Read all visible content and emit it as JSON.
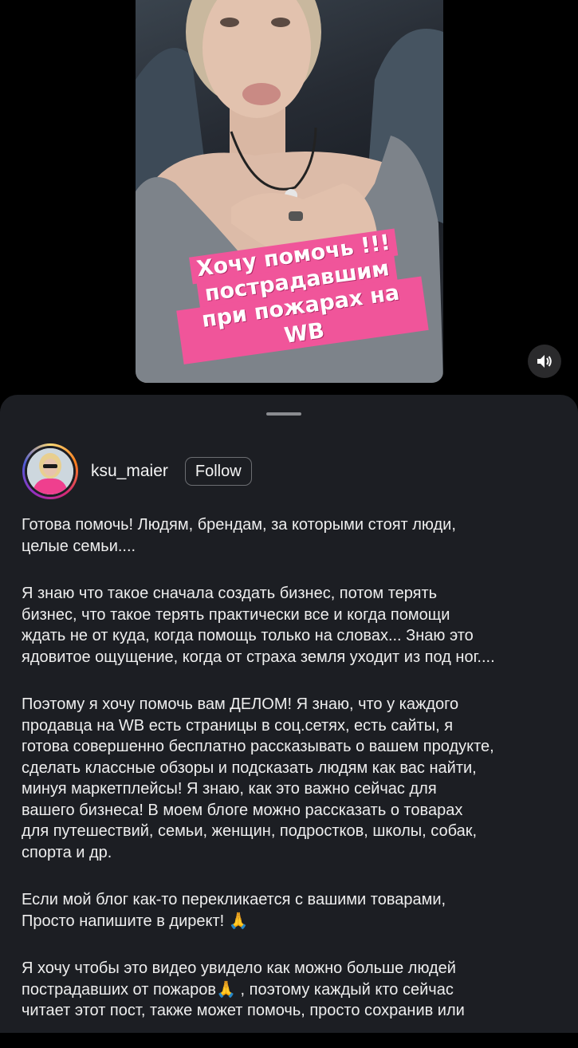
{
  "video": {
    "overlay_lines": [
      "Хочу помочь !!!",
      "пострадавшим",
      "при пожарах на WB"
    ],
    "sound_icon": "speaker-icon"
  },
  "post": {
    "username": "ksu_maier",
    "follow_label": "Follow",
    "paragraphs": [
      "Готова помочь! Людям, брендам, за которыми стоят люди,\nцелые семьи....",
      "Я знаю что такое сначала создать бизнес, потом терять\nбизнес, что такое терять практически все и когда помощи\nждать не от куда, когда помощь только на словах... Знаю это\nядовитое ощущение, когда от страха земля уходит из под ног....",
      "Поэтому я  хочу помочь вам ДЕЛОМ! Я знаю, что у каждого\nпродавца  на WB есть страницы в соц.сетях, есть сайты, я\nготова совершенно бесплатно рассказывать о вашем продукте,\nсделать классные обзоры и подсказать людям как вас найти,\nминуя маркетплейсы!  Я знаю, как это важно сейчас для\nвашего бизнеса!  В моем блоге можно рассказать о товарах\nдля путешествий, семьи, женщин, подростков, школы, собак,\nспорта и др.",
      "Если мой блог как-то перекликается с вашими товарами,\nПросто напишите в директ! 🙏",
      "Я хочу чтобы это видео увидело как можно больше людей\nпострадавших от пожаров🙏 , поэтому каждый кто сейчас\nчитает этот пост, также может помочь, просто сохранив или"
    ]
  },
  "colors": {
    "sheet_bg": "#1c1e23",
    "overlay_pink": "#f0559a",
    "text": "#eeeeee"
  }
}
